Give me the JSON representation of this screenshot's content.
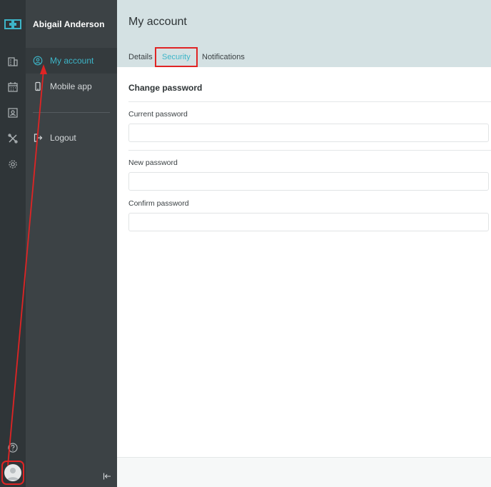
{
  "user": {
    "name": "Abigail Anderson"
  },
  "rail": {
    "icons": [
      "logo-icon",
      "building-icon",
      "calendar-icon",
      "badge-icon",
      "tools-icon",
      "gear-icon",
      "help-icon",
      "avatar-icon"
    ]
  },
  "menu": {
    "items": [
      {
        "label": "My account",
        "icon": "user-circle-icon",
        "active": true
      },
      {
        "label": "Mobile app",
        "icon": "phone-icon",
        "active": false
      },
      {
        "label": "Logout",
        "icon": "logout-icon",
        "active": false
      }
    ],
    "collapse_icon": "collapse-left-icon"
  },
  "page": {
    "title": "My account",
    "tabs": [
      {
        "label": "Details",
        "active": false
      },
      {
        "label": "Security",
        "active": true
      },
      {
        "label": "Notifications",
        "active": false
      }
    ]
  },
  "form": {
    "section_title": "Change password",
    "fields": [
      {
        "label": "Current password",
        "value": ""
      },
      {
        "label": "New password",
        "value": ""
      },
      {
        "label": "Confirm password",
        "value": ""
      }
    ]
  },
  "colors": {
    "accent": "#3db5c8",
    "rail_bg": "#2f3538",
    "nav_bg": "#3c4245",
    "header_bg": "#d4e1e3",
    "annotation": "#e02424"
  }
}
